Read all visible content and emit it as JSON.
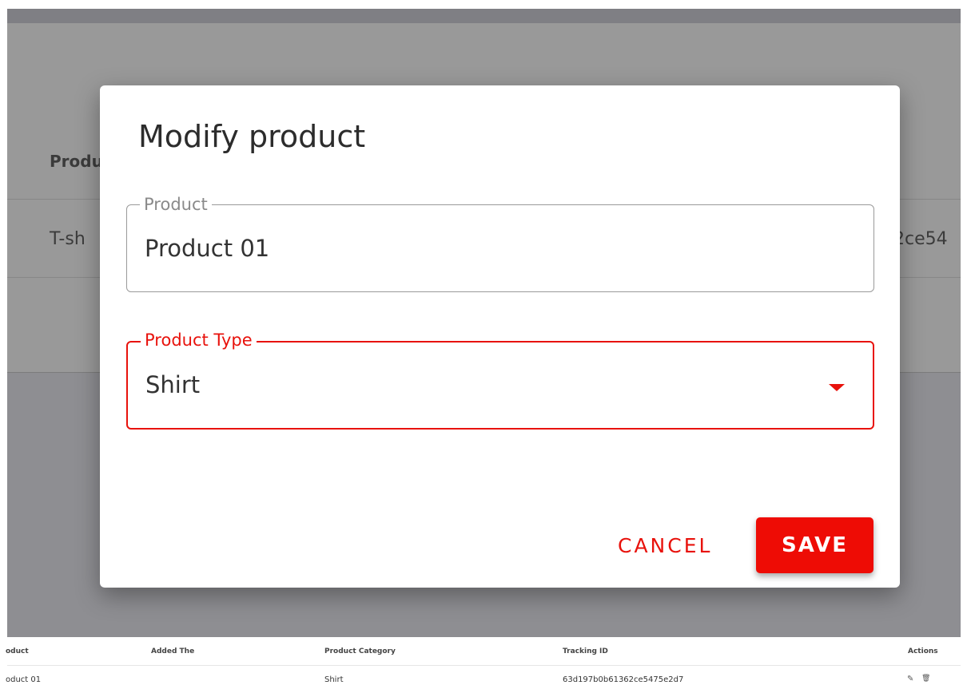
{
  "background_table": {
    "header_partial": "Produ",
    "row_partial_left": "T-sh",
    "row_partial_right": "2ce54"
  },
  "modal": {
    "title": "Modify product",
    "product_field": {
      "label": "Product",
      "value": "Product 01"
    },
    "type_field": {
      "label": "Product Type",
      "value": "Shirt"
    },
    "cancel_label": "CANCEL",
    "save_label": "SAVE"
  },
  "table": {
    "headers": [
      "oduct",
      "Added The",
      "Product Category",
      "Tracking ID",
      "Actions"
    ],
    "row": {
      "product": "oduct 01",
      "category": "Shirt",
      "tracking_id": "63d197b0b61362ce5475e2d7",
      "edit_icon": "✎",
      "delete_icon": "🗑"
    }
  },
  "colors": {
    "accent": "#e8120c",
    "save_button": "#ee0c05"
  }
}
